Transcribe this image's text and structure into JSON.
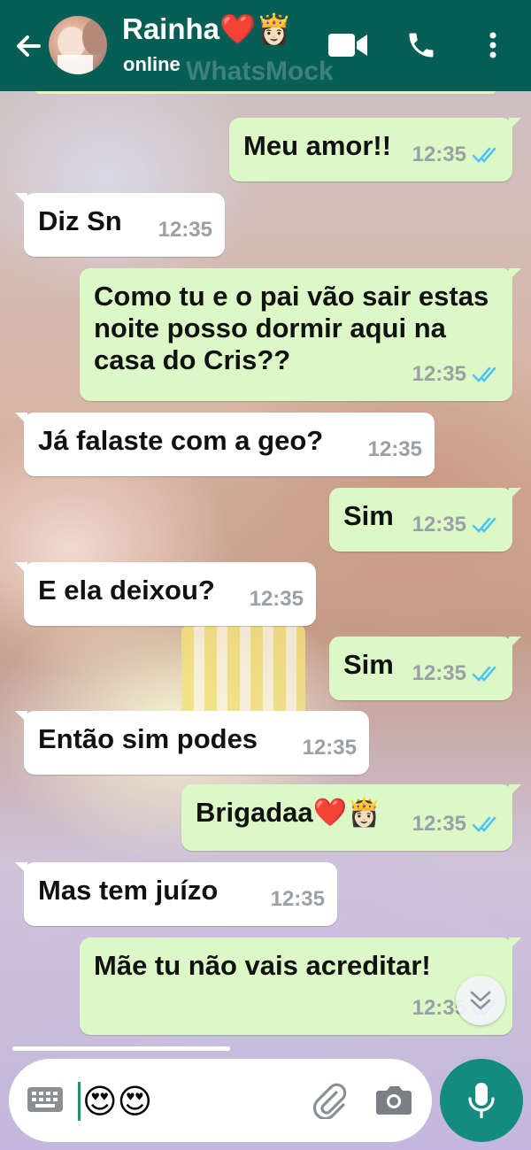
{
  "header": {
    "contact_name": "Rainha❤️👸🏻",
    "status": "online",
    "watermark": "WhatsMock"
  },
  "messages": [
    {
      "dir": "out",
      "text": "Meu amor!!",
      "time": "12:35",
      "read": true
    },
    {
      "dir": "in",
      "text": "Diz Sn",
      "time": "12:35"
    },
    {
      "dir": "out",
      "text": "Como tu e o pai vão sair estas noite posso dormir aqui na casa do Cris??",
      "time": "12:35",
      "read": true
    },
    {
      "dir": "in",
      "text": "Já falaste com a geo?",
      "time": "12:35"
    },
    {
      "dir": "out",
      "text": "Sim",
      "time": "12:35",
      "read": true
    },
    {
      "dir": "in",
      "text": "E ela deixou?",
      "time": "12:35"
    },
    {
      "dir": "out",
      "text": "Sim",
      "time": "12:35",
      "read": true
    },
    {
      "dir": "in",
      "text": "Então sim podes",
      "time": "12:35"
    },
    {
      "dir": "out",
      "text": "Brigadaa❤️👸🏻",
      "time": "12:35",
      "read": true
    },
    {
      "dir": "in",
      "text": "Mas tem juízo",
      "time": "12:35"
    },
    {
      "dir": "out",
      "text": "Mãe tu não vais acreditar!",
      "time": "12:35",
      "read": true
    }
  ],
  "composer": {
    "draft": "😍😍"
  },
  "icons": {
    "back": "arrow-left-icon",
    "video": "video-camera-icon",
    "call": "phone-icon",
    "menu": "more-vertical-icon",
    "keyboard": "keyboard-icon",
    "attach": "paperclip-icon",
    "camera": "camera-icon",
    "mic": "microphone-icon",
    "scroll": "double-chevron-down-icon"
  },
  "colors": {
    "header": "#075e54",
    "outgoing_bubble": "#dcf8c6",
    "incoming_bubble": "#ffffff",
    "read_ticks": "#4fc3f7",
    "mic_button": "#128c7e"
  }
}
